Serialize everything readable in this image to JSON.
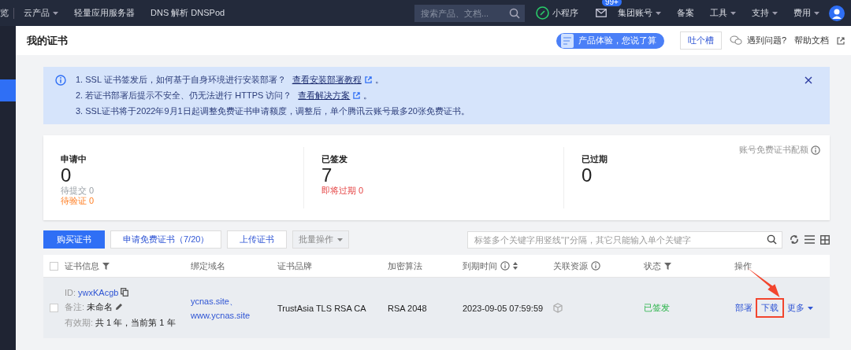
{
  "topnav": {
    "cut_item": "览",
    "items": [
      {
        "label": "云产品",
        "dropdown": true
      },
      {
        "label": "轻量应用服务器",
        "dropdown": false
      },
      {
        "label": "DNS 解析 DNSPod",
        "dropdown": false
      }
    ],
    "search": {
      "placeholder": "搜索产品、文档..."
    },
    "mini_program": "小程序",
    "mail_badge": "99+",
    "right_items": [
      {
        "label": "集团账号",
        "dropdown": true
      },
      {
        "label": "备案",
        "dropdown": false
      },
      {
        "label": "工具",
        "dropdown": true
      },
      {
        "label": "支持",
        "dropdown": true
      },
      {
        "label": "费用",
        "dropdown": true
      }
    ]
  },
  "header": {
    "title": "我的证书",
    "banner": "产品体验，您说了算",
    "feedback_button": "吐个槽",
    "help_link": "遇到问题?",
    "docs_link": "帮助文档"
  },
  "notice": {
    "lines": [
      {
        "text": "1. SSL 证书签发后，如何基于自身环境进行安装部署？",
        "link": "查看安装部署教程",
        "end": "。"
      },
      {
        "text": "2. 若证书部署后提示不安全、仍无法进行 HTTPS 访问？",
        "link": "查看解决方案",
        "end": "。"
      },
      {
        "text": "3. SSL证书将于2022年9月1日起调整免费证书申请额度，调整后，单个腾讯云账号最多20张免费证书。"
      }
    ]
  },
  "stats": {
    "quota_label": "账号免费证书配额",
    "groups": [
      {
        "label": "申请中",
        "count": "0",
        "details": [
          {
            "text": "待提交 0",
            "kind": "muted"
          },
          {
            "text": "待验证 0",
            "kind": "warning"
          }
        ]
      },
      {
        "label": "已签发",
        "count": "7",
        "details": [
          {
            "text": "即将过期 0",
            "kind": "danger"
          }
        ]
      },
      {
        "label": "已过期",
        "count": "0"
      }
    ]
  },
  "toolbar": {
    "buttons": [
      {
        "label": "购买证书",
        "kind": "primary",
        "dropdown": false
      },
      {
        "label": "申请免费证书（7/20）",
        "kind": "default",
        "dropdown": false
      },
      {
        "label": "上传证书",
        "kind": "default",
        "dropdown": false
      },
      {
        "label": "批量操作",
        "kind": "disabled",
        "dropdown": true
      }
    ],
    "search": {
      "placeholder": "标签多个关键字用竖线\"|\"分隔，其它只能输入单个关键字"
    }
  },
  "table": {
    "all_checked": false,
    "columns": [
      {
        "label": "证书信息",
        "kind": "filter"
      },
      {
        "label": "绑定域名",
        "kind": "plain"
      },
      {
        "label": "证书品牌",
        "kind": "plain"
      },
      {
        "label": "加密算法",
        "kind": "plain"
      },
      {
        "label": "到期时间",
        "kind": "info-sort"
      },
      {
        "label": "关联资源",
        "kind": "info"
      },
      {
        "label": "状态",
        "kind": "filter"
      },
      {
        "label": "操作",
        "kind": "plain"
      }
    ],
    "rows": [
      {
        "checked": false,
        "id_label": "ID:",
        "id": "ywxKAcgb",
        "remark_label": "备注:",
        "remark": "未命名",
        "validity_label": "有效期:",
        "validity": "共 1 年，当前第 1 年",
        "domains": [
          "ycnas.site、",
          "www.ycnas.site"
        ],
        "brand": "TrustAsia TLS RSA CA",
        "algorithm": "RSA 2048",
        "expiry": "2023-09-05 07:59:59",
        "status": "已签发",
        "actions": [
          {
            "label": "部署",
            "highlighted": false
          },
          {
            "label": "下载",
            "highlighted": true
          }
        ],
        "more": "更多"
      }
    ]
  }
}
